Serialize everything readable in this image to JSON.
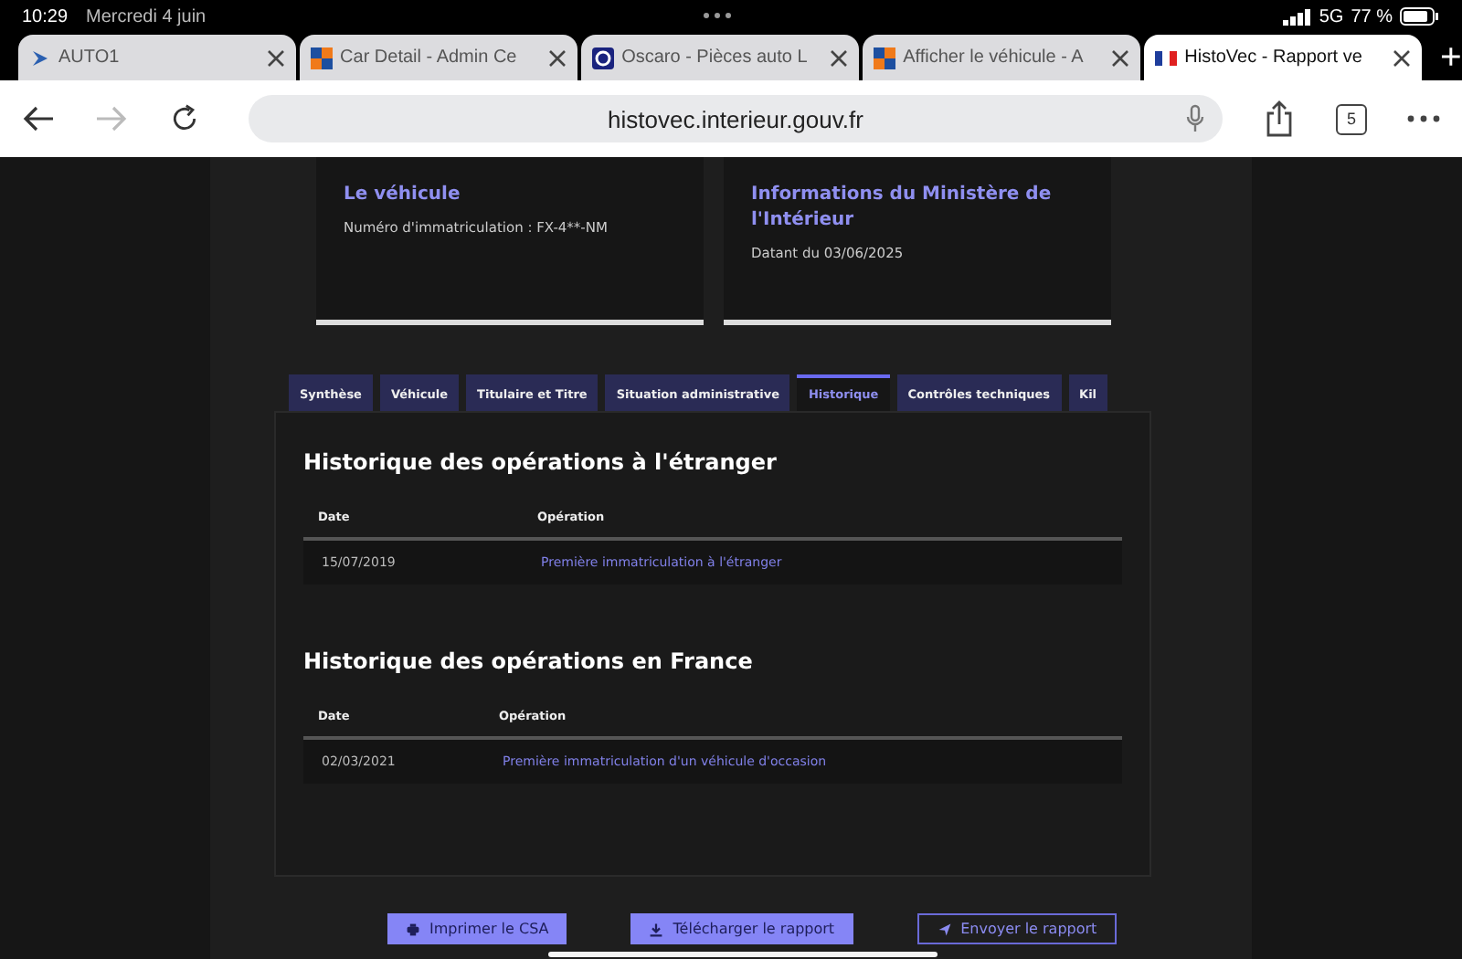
{
  "status_bar": {
    "time": "10:29",
    "date": "Mercredi 4 juin",
    "network": "5G",
    "battery": "77 %"
  },
  "browser_tabs": [
    {
      "title": "AUTO1",
      "kind": "arrow",
      "selected": false
    },
    {
      "title": "Car Detail - Admin Ce",
      "kind": "squares",
      "selected": false
    },
    {
      "title": "Oscaro - Pièces auto L",
      "kind": "disc",
      "selected": false
    },
    {
      "title": "Afficher le véhicule - A",
      "kind": "squares",
      "selected": false
    },
    {
      "title": "HistoVec - Rapport ve",
      "kind": "flag",
      "selected": true
    }
  ],
  "toolbar": {
    "address": "histovec.interieur.gouv.fr",
    "tab_count": "5"
  },
  "cards": [
    {
      "title": "Le véhicule",
      "text": "Numéro d'immatriculation : FX-4**-NM"
    },
    {
      "title": "Informations du Ministère de l'Intérieur",
      "text": "Datant du 03/06/2025"
    }
  ],
  "page_tabs": [
    {
      "label": "Synthèse",
      "selected": false
    },
    {
      "label": "Véhicule",
      "selected": false
    },
    {
      "label": "Titulaire et Titre",
      "selected": false
    },
    {
      "label": "Situation administrative",
      "selected": false
    },
    {
      "label": "Historique",
      "selected": true
    },
    {
      "label": "Contrôles techniques",
      "selected": false
    },
    {
      "label": "Kil",
      "selected": false
    }
  ],
  "sections": [
    {
      "title": "Historique des opérations à l'étranger",
      "columns": [
        "Date",
        "Opération"
      ],
      "rows": [
        {
          "date": "15/07/2019",
          "operation": "Première immatriculation à l'étranger"
        }
      ]
    },
    {
      "title": "Historique des opérations en France",
      "columns": [
        "Date",
        "Opération"
      ],
      "rows": [
        {
          "date": "02/03/2021",
          "operation": "Première immatriculation d'un véhicule d'occasion"
        }
      ]
    }
  ],
  "actions": [
    {
      "label": "Imprimer le CSA",
      "kind": "print"
    },
    {
      "label": "Télécharger le rapport",
      "kind": "download"
    },
    {
      "label": "Envoyer le rapport",
      "kind": "send"
    }
  ]
}
